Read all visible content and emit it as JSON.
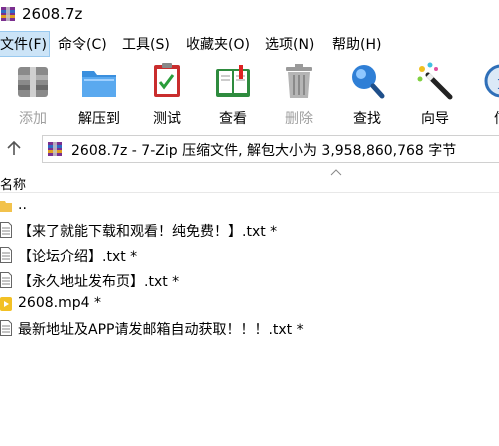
{
  "window": {
    "title": "2608.7z"
  },
  "menu": [
    "文件(F)",
    "命令(C)",
    "工具(S)",
    "收藏夹(O)",
    "选项(N)",
    "帮助(H)"
  ],
  "toolbar": [
    {
      "label": "添加",
      "icon": "add-archive-icon",
      "enabled": false
    },
    {
      "label": "解压到",
      "icon": "extract-folder-icon",
      "enabled": true
    },
    {
      "label": "测试",
      "icon": "test-checklist-icon",
      "enabled": true
    },
    {
      "label": "查看",
      "icon": "view-book-icon",
      "enabled": true
    },
    {
      "label": "删除",
      "icon": "trash-can-icon",
      "enabled": false
    },
    {
      "label": "查找",
      "icon": "magnifier-icon",
      "enabled": true
    },
    {
      "label": "向导",
      "icon": "wizard-wand-icon",
      "enabled": true
    },
    {
      "label": "信",
      "icon": "info-icon",
      "enabled": true
    }
  ],
  "address": {
    "text": "2608.7z - 7-Zip 压缩文件, 解包大小为 3,958,860,768 字节"
  },
  "columns": {
    "name": "名称"
  },
  "files": [
    {
      "name": "..",
      "type": "folder"
    },
    {
      "name": "【来了就能下载和观看！纯免费！】.txt *",
      "type": "text"
    },
    {
      "name": "【论坛介绍】.txt *",
      "type": "text"
    },
    {
      "name": "【永久地址发布页】.txt *",
      "type": "text"
    },
    {
      "name": "2608.mp4 *",
      "type": "video"
    },
    {
      "name": "最新地址及APP请发邮箱自动获取！！！.txt *",
      "type": "text"
    }
  ],
  "colors": {
    "menu_highlight": "#cce4f7",
    "disabled_text": "#a0a0a0"
  }
}
